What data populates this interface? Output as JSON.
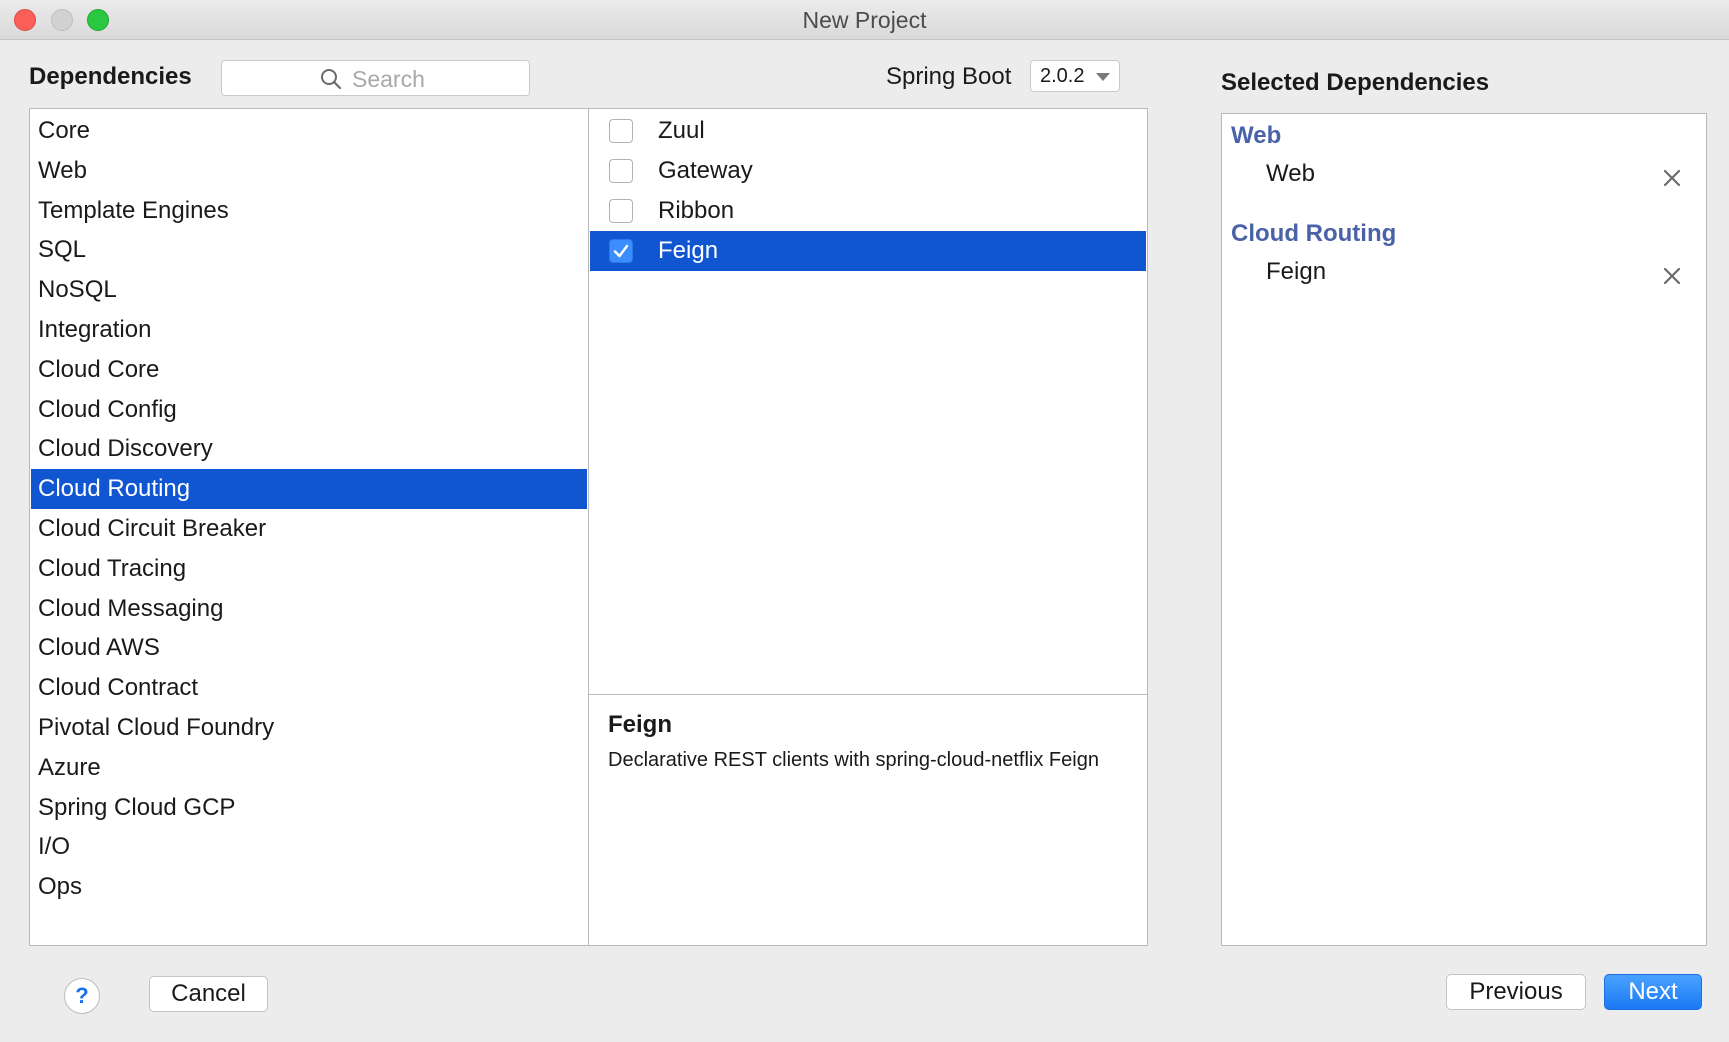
{
  "window": {
    "title": "New Project"
  },
  "header": {
    "dependencies_label": "Dependencies",
    "search_placeholder": "Search",
    "spring_boot_label": "Spring Boot",
    "spring_boot_version": "2.0.2",
    "selected_dependencies_label": "Selected Dependencies"
  },
  "categories": [
    "Core",
    "Web",
    "Template Engines",
    "SQL",
    "NoSQL",
    "Integration",
    "Cloud Core",
    "Cloud Config",
    "Cloud Discovery",
    "Cloud Routing",
    "Cloud Circuit Breaker",
    "Cloud Tracing",
    "Cloud Messaging",
    "Cloud AWS",
    "Cloud Contract",
    "Pivotal Cloud Foundry",
    "Azure",
    "Spring Cloud GCP",
    "I/O",
    "Ops"
  ],
  "selected_category": "Cloud Routing",
  "dependencies": [
    {
      "label": "Zuul",
      "checked": false
    },
    {
      "label": "Gateway",
      "checked": false
    },
    {
      "label": "Ribbon",
      "checked": false
    },
    {
      "label": "Feign",
      "checked": true
    }
  ],
  "description": {
    "title": "Feign",
    "text": "Declarative REST clients with spring-cloud-netflix Feign"
  },
  "selected": [
    {
      "group": "Web",
      "items": [
        "Web"
      ]
    },
    {
      "group": "Cloud Routing",
      "items": [
        "Feign"
      ]
    }
  ],
  "footer": {
    "help_label": "?",
    "cancel_label": "Cancel",
    "previous_label": "Previous",
    "next_label": "Next"
  },
  "colors": {
    "selection": "#0f56d0",
    "group_title": "#4a62a8",
    "primary_button": "#1a79f4"
  }
}
